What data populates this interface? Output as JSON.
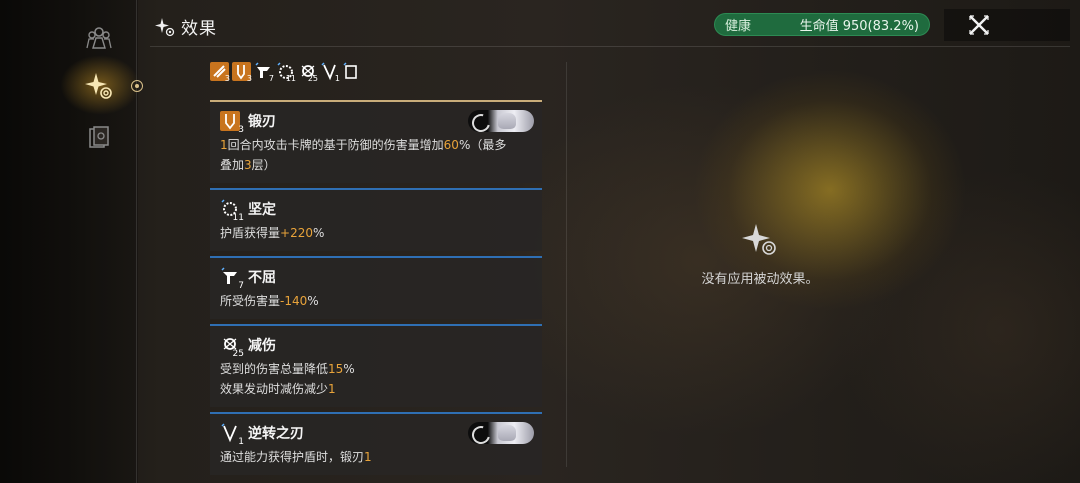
{
  "panel": {
    "title": "效果"
  },
  "health": {
    "status": "健康",
    "value_text": "生命值 950(83.2%)",
    "percent": 83.2
  },
  "buffs": [
    {
      "icon": "blade-buff-icon",
      "stacks": "3",
      "color": "orange"
    },
    {
      "icon": "forge-blade-icon",
      "stacks": "3",
      "color": "orange"
    },
    {
      "icon": "unyielding-icon",
      "stacks": "7",
      "color": "dark"
    },
    {
      "icon": "steadfast-icon",
      "stacks": "11",
      "color": "dark"
    },
    {
      "icon": "damage-reduction-icon",
      "stacks": "25",
      "color": "dark"
    },
    {
      "icon": "reverse-blade-icon",
      "stacks": "1",
      "color": "dark"
    },
    {
      "icon": "card-buff-icon",
      "stacks": "",
      "color": "dark"
    }
  ],
  "effects": [
    {
      "name": "锻刃",
      "stacks": "3",
      "desc1_a": "1",
      "desc1_b": "回合内攻击卡牌的基于防御的伤害量增加",
      "desc1_c": "60",
      "desc1_d": "%（最多",
      "desc2_a": "叠加",
      "desc2_b": "3",
      "desc2_c": "层）"
    },
    {
      "name": "坚定",
      "stacks": "11",
      "desc_a": "护盾获得量",
      "desc_b": "+220",
      "desc_c": "%"
    },
    {
      "name": "不屈",
      "stacks": "7",
      "desc_a": "所受伤害量",
      "desc_b": "-140",
      "desc_c": "%"
    },
    {
      "name": "减伤",
      "stacks": "25",
      "desc1_a": "受到的伤害总量降低",
      "desc1_b": "15",
      "desc1_c": "%",
      "desc2_a": "效果发动时减伤减少",
      "desc2_b": "1"
    },
    {
      "name": "逆转之刃",
      "stacks": "1",
      "desc_a": "通过能力获得护盾时，锻刃",
      "desc_b": "1"
    }
  ],
  "passive": {
    "empty_text": "没有应用被动效果。"
  },
  "colors": {
    "accent_orange": "#e8a33a",
    "health_green": "#1f6b3e",
    "card_border_blue": "#2f6fb3"
  }
}
